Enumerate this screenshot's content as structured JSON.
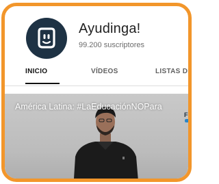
{
  "channel": {
    "name": "Ayudinga!",
    "subscribers": "99.200 suscriptores",
    "avatar_icon": "smiley-logo-icon",
    "avatar_color": "#1e3244"
  },
  "tabs": [
    {
      "label": "INICIO",
      "active": true
    },
    {
      "label": "VÍDEOS",
      "active": false
    },
    {
      "label": "LISTAS DE",
      "active": false
    }
  ],
  "video": {
    "title": "América Latina: #LaEducaciónNOPara",
    "side_logo_text": "Fu"
  },
  "colors": {
    "frame_border": "#f2962b",
    "active_tab": "#111111"
  }
}
